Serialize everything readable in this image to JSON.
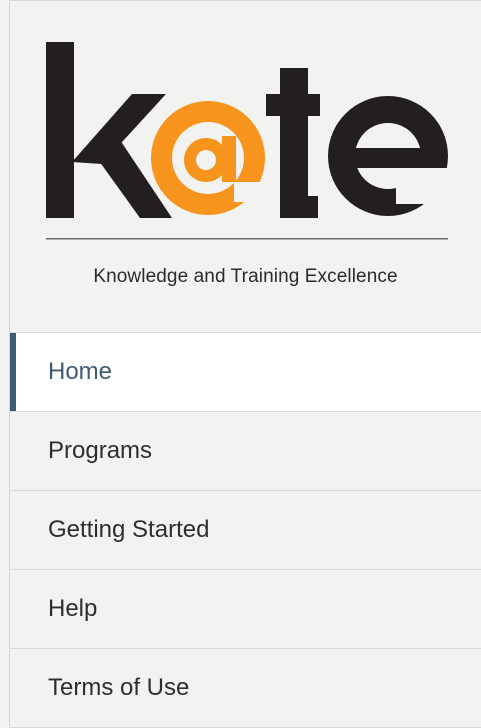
{
  "brand": {
    "logo_text": "k@te",
    "tagline": "Knowledge and Training Excellence",
    "colors": {
      "dark": "#231f20",
      "accent": "#f7941d"
    }
  },
  "nav": {
    "items": [
      {
        "label": "Home",
        "active": true
      },
      {
        "label": "Programs",
        "active": false
      },
      {
        "label": "Getting Started",
        "active": false
      },
      {
        "label": "Help",
        "active": false
      },
      {
        "label": "Terms of Use",
        "active": false
      }
    ],
    "active_color": "#3f5a73"
  }
}
